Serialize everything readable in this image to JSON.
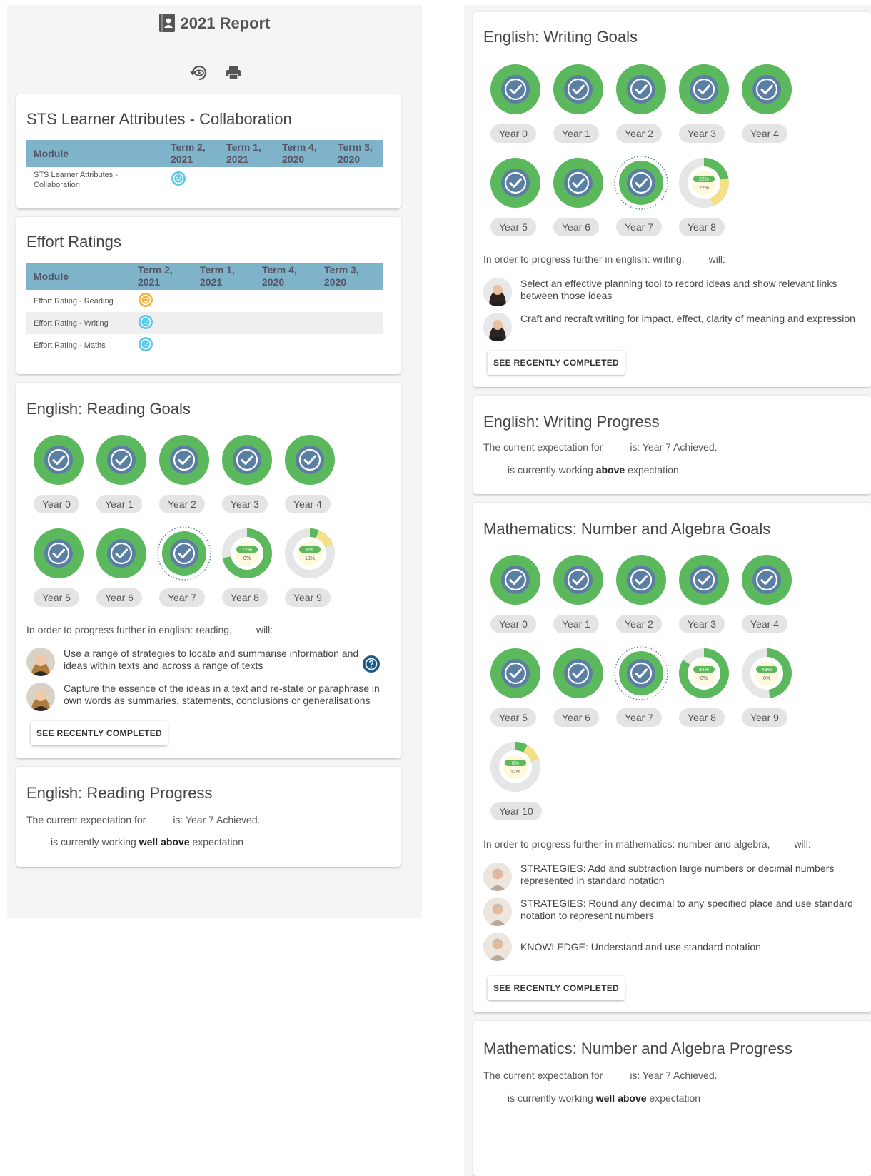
{
  "header": {
    "title": "2021 Report",
    "icons": [
      "report-book-icon",
      "view-icon",
      "print-icon"
    ]
  },
  "collaboration": {
    "title": "STS Learner Attributes - Collaboration",
    "columns": [
      "Module",
      "Term 2, 2021",
      "Term 1, 2021",
      "Term 4, 2020",
      "Term 3, 2020"
    ],
    "rows": [
      {
        "module": "STS Learner Attributes - Collaboration",
        "term2_2021": "happy-face-blue"
      }
    ]
  },
  "effort": {
    "title": "Effort Ratings",
    "columns": [
      "Module",
      "Term 2, 2021",
      "Term 1, 2021",
      "Term 4, 2020",
      "Term 3, 2020"
    ],
    "rows": [
      {
        "module": "Effort Rating - Reading",
        "term2_2021": "face-orange"
      },
      {
        "module": "Effort Rating - Writing",
        "term2_2021": "happy-face-blue"
      },
      {
        "module": "Effort Rating - Maths",
        "term2_2021": "happy-face-blue"
      }
    ]
  },
  "reading_goals": {
    "title": "English: Reading Goals",
    "years": [
      {
        "label": "Year 0",
        "status": "complete"
      },
      {
        "label": "Year 1",
        "status": "complete"
      },
      {
        "label": "Year 2",
        "status": "complete"
      },
      {
        "label": "Year 3",
        "status": "complete"
      },
      {
        "label": "Year 4",
        "status": "complete"
      },
      {
        "label": "Year 5",
        "status": "complete"
      },
      {
        "label": "Year 6",
        "status": "complete"
      },
      {
        "label": "Year 7",
        "status": "current-complete"
      },
      {
        "label": "Year 8",
        "status": "partial",
        "green": 0.72,
        "yellow": 0.0,
        "top_text": "72%",
        "bottom_text": "0%"
      },
      {
        "label": "Year 9",
        "status": "partial",
        "green": 0.06,
        "yellow": 0.13,
        "top_text": "6%",
        "bottom_text": "13%"
      }
    ],
    "intro": "In order to progress further in english: reading,",
    "intro_will": "will:",
    "items": [
      "Use a range of strategies to locate and summarise information and ideas within texts and across a range of texts",
      "Capture the essence of the ideas in a text and re-state or paraphrase in own words as summaries, statements, conclusions or generalisations"
    ],
    "button": "SEE RECENTLY COMPLETED"
  },
  "reading_progress": {
    "title": "English: Reading Progress",
    "line1_a": "The current expectation for",
    "line1_b": "is: Year 7 Achieved.",
    "line2_a": "is currently working",
    "line2_bold": "well above",
    "line2_b": "expectation"
  },
  "writing_goals": {
    "title": "English: Writing Goals",
    "years": [
      {
        "label": "Year 0",
        "status": "complete"
      },
      {
        "label": "Year 1",
        "status": "complete"
      },
      {
        "label": "Year 2",
        "status": "complete"
      },
      {
        "label": "Year 3",
        "status": "complete"
      },
      {
        "label": "Year 4",
        "status": "complete"
      },
      {
        "label": "Year 5",
        "status": "complete"
      },
      {
        "label": "Year 6",
        "status": "complete"
      },
      {
        "label": "Year 7",
        "status": "current-complete"
      },
      {
        "label": "Year 8",
        "status": "partial",
        "green": 0.22,
        "yellow": 0.22,
        "top_text": "22%",
        "bottom_text": "22%"
      }
    ],
    "intro": "In order to progress further in english: writing,",
    "intro_will": "will:",
    "items": [
      "Select an effective planning tool to record ideas and show relevant links between those ideas",
      "Craft and recraft writing for impact, effect, clarity of meaning and expression"
    ],
    "button": "SEE RECENTLY COMPLETED"
  },
  "writing_progress": {
    "title": "English: Writing Progress",
    "line1_a": "The current expectation for",
    "line1_b": "is: Year 7 Achieved.",
    "line2_a": "is currently working",
    "line2_bold": "above",
    "line2_b": "expectation"
  },
  "maths_goals": {
    "title": "Mathematics: Number and Algebra Goals",
    "years": [
      {
        "label": "Year 0",
        "status": "complete"
      },
      {
        "label": "Year 1",
        "status": "complete"
      },
      {
        "label": "Year 2",
        "status": "complete"
      },
      {
        "label": "Year 3",
        "status": "complete"
      },
      {
        "label": "Year 4",
        "status": "complete"
      },
      {
        "label": "Year 5",
        "status": "complete"
      },
      {
        "label": "Year 6",
        "status": "complete"
      },
      {
        "label": "Year 7",
        "status": "current-complete"
      },
      {
        "label": "Year 8",
        "status": "partial",
        "green": 0.84,
        "yellow": 0.0,
        "top_text": "84%",
        "bottom_text": "0%"
      },
      {
        "label": "Year 9",
        "status": "partial",
        "green": 0.48,
        "yellow": 0.0,
        "top_text": "48%",
        "bottom_text": "0%"
      },
      {
        "label": "Year 10",
        "status": "partial",
        "green": 0.08,
        "yellow": 0.12,
        "top_text": "8%",
        "bottom_text": "12%"
      }
    ],
    "intro": "In order to progress further in mathematics: number and algebra,",
    "intro_will": "will:",
    "items": [
      "STRATEGIES: Add and subtraction large numbers or decimal numbers represented in standard notation",
      "STRATEGIES: Round any decimal to any specified place and use standard notation to represent numbers",
      "KNOWLEDGE: Understand and use standard notation"
    ],
    "button": "SEE RECENTLY COMPLETED"
  },
  "maths_progress": {
    "title": "Mathematics: Number and Algebra Progress",
    "line1_a": "The current expectation for",
    "line1_b": "is: Year 7 Achieved.",
    "line2_a": "is currently working",
    "line2_bold": "well above",
    "line2_b": "expectation"
  },
  "colors": {
    "green": "#5cb85c",
    "badge_blue": "#5a7fa3",
    "yellow": "#f5e08a",
    "grey_ring": "#e6e6e6",
    "face_blue": "#5bc8e8",
    "face_orange": "#f4b642",
    "table_header": "#7fb3c9"
  }
}
